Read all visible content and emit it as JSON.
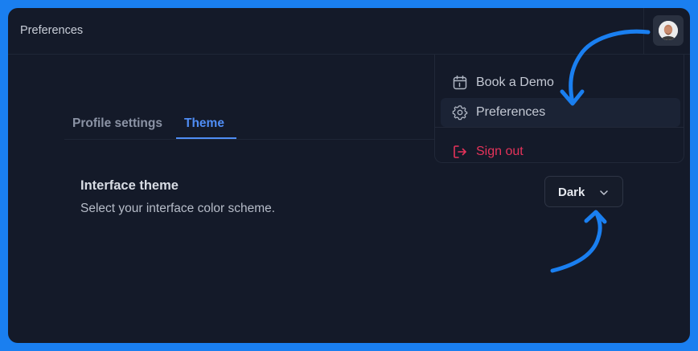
{
  "header": {
    "title": "Preferences"
  },
  "user_menu": {
    "avatar_icon": "user-avatar",
    "items": [
      {
        "label": "Book a Demo",
        "icon": "calendar-icon",
        "active": false
      },
      {
        "label": "Preferences",
        "icon": "gear-icon",
        "active": true
      },
      {
        "label": "Sign out",
        "icon": "sign-out-icon",
        "active": false
      }
    ]
  },
  "tabs": [
    {
      "label": "Profile settings",
      "active": false
    },
    {
      "label": "Theme",
      "active": true
    }
  ],
  "theme_setting": {
    "title": "Interface theme",
    "description": "Select your interface color scheme.",
    "selected_value": "Dark"
  },
  "colors": {
    "accent": "#4f8df5",
    "danger": "#e5335a",
    "background": "#141a29",
    "annotation": "#1a7ff0"
  }
}
